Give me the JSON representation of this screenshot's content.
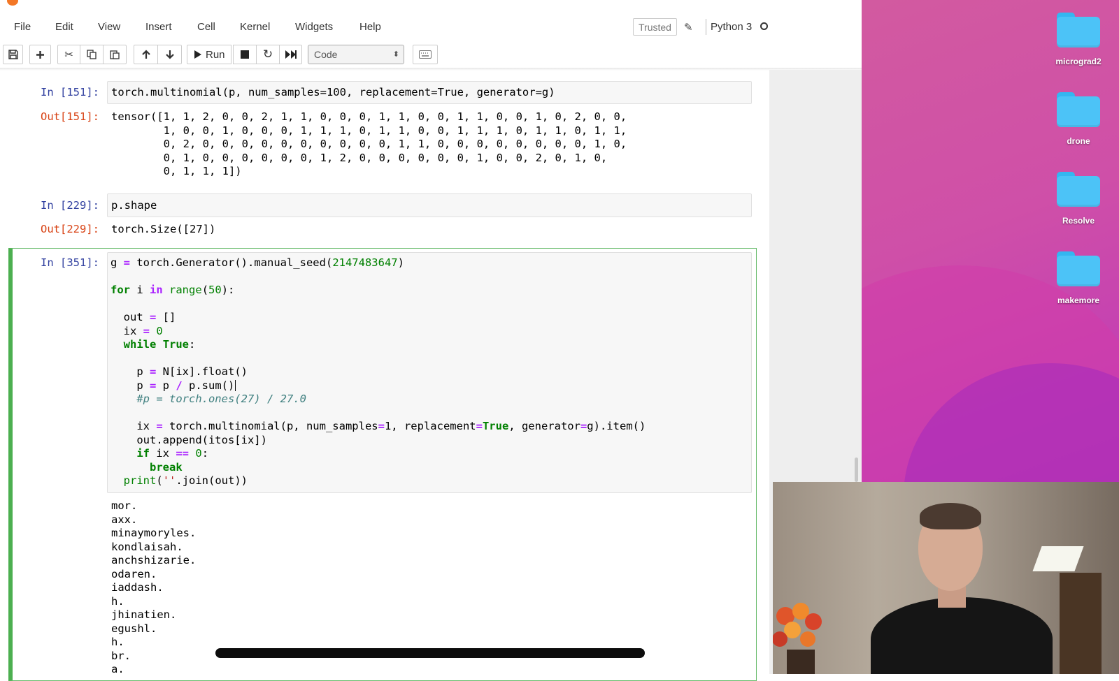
{
  "menu": [
    "File",
    "Edit",
    "View",
    "Insert",
    "Cell",
    "Kernel",
    "Widgets",
    "Help"
  ],
  "status": {
    "trusted": "Trusted",
    "kernel": "Python 3"
  },
  "toolbar": {
    "run_label": "Run",
    "cell_type": "Code"
  },
  "cells": {
    "c151": {
      "in_prompt": "In [151]:",
      "code": "torch.multinomial(p, num_samples=100, replacement=True, generator=g)",
      "out_prompt": "Out[151]:",
      "output": "tensor([1, 1, 2, 0, 0, 2, 1, 1, 0, 0, 0, 1, 1, 0, 0, 1, 1, 0, 0, 1, 0, 2, 0, 0,\n        1, 0, 0, 1, 0, 0, 0, 1, 1, 1, 0, 1, 1, 0, 0, 1, 1, 1, 0, 1, 1, 0, 1, 1,\n        0, 2, 0, 0, 0, 0, 0, 0, 0, 0, 0, 0, 1, 1, 0, 0, 0, 0, 0, 0, 0, 0, 1, 0,\n        0, 1, 0, 0, 0, 0, 0, 0, 1, 2, 0, 0, 0, 0, 0, 0, 1, 0, 0, 2, 0, 1, 0,\n        0, 1, 1, 1])"
    },
    "c229": {
      "in_prompt": "In [229]:",
      "code": "p.shape",
      "out_prompt": "Out[229]:",
      "output": "torch.Size([27])"
    },
    "c351": {
      "in_prompt": "In [351]:",
      "code_lines": [
        "g = torch.Generator().manual_seed(2147483647)",
        "",
        "for i in range(50):",
        "",
        "  out = []",
        "  ix = 0",
        "  while True:",
        "",
        "    p = N[ix].float()",
        "    p = p / p.sum()",
        "    #p = torch.ones(27) / 27.0",
        "",
        "    ix = torch.multinomial(p, num_samples=1, replacement=True, generator=g).item()",
        "    out.append(itos[ix])",
        "    if ix == 0:",
        "      break",
        "  print(''.join(out))"
      ],
      "output_lines": [
        "mor.",
        "axx.",
        "minaymoryles.",
        "kondlaisah.",
        "anchshizarie.",
        "odaren.",
        "iaddash.",
        "h.",
        "jhinatien.",
        "egushl.",
        "h.",
        "br.",
        "a."
      ]
    }
  },
  "desktop": {
    "folders": [
      "micrograd2",
      "drone",
      "Resolve",
      "makemore"
    ]
  },
  "colors": {
    "prompt_in": "#303f9f",
    "prompt_out": "#d84315",
    "selected_border": "#4caf50",
    "folder": "#4cc3f7"
  }
}
